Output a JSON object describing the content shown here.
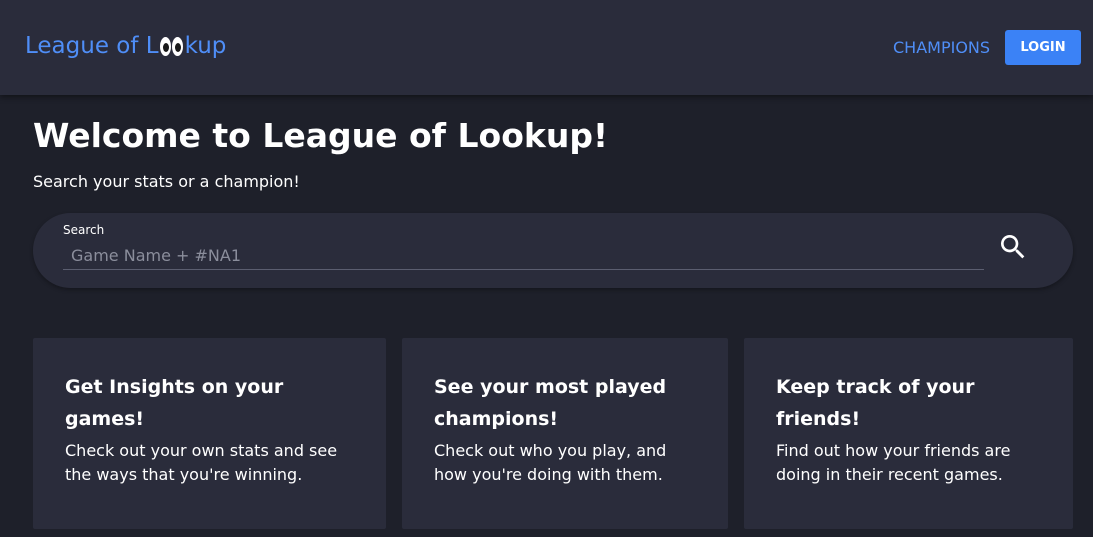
{
  "navbar": {
    "logo_prefix": "League of L",
    "logo_suffix": "kup",
    "champions_label": "CHAMPIONS",
    "login_label": "LOGIN"
  },
  "hero": {
    "title": "Welcome to League of Lookup!",
    "subtitle": "Search your stats or a champion!"
  },
  "search": {
    "label": "Search",
    "placeholder": "Game Name + #NA1",
    "value": "",
    "icon": "search-icon"
  },
  "cards": [
    {
      "title": "Get Insights on your games!",
      "text": "Check out your own stats and see the ways that you're winning."
    },
    {
      "title": "See your most played champions!",
      "text": "Check out who you play, and how you're doing with them."
    },
    {
      "title": "Keep track of your friends!",
      "text": "Find out how your friends are doing in their recent games."
    }
  ],
  "colors": {
    "accent": "#4f8ef7",
    "button": "#3b82f6",
    "background": "#1e202a",
    "surface": "#2a2c3b"
  }
}
